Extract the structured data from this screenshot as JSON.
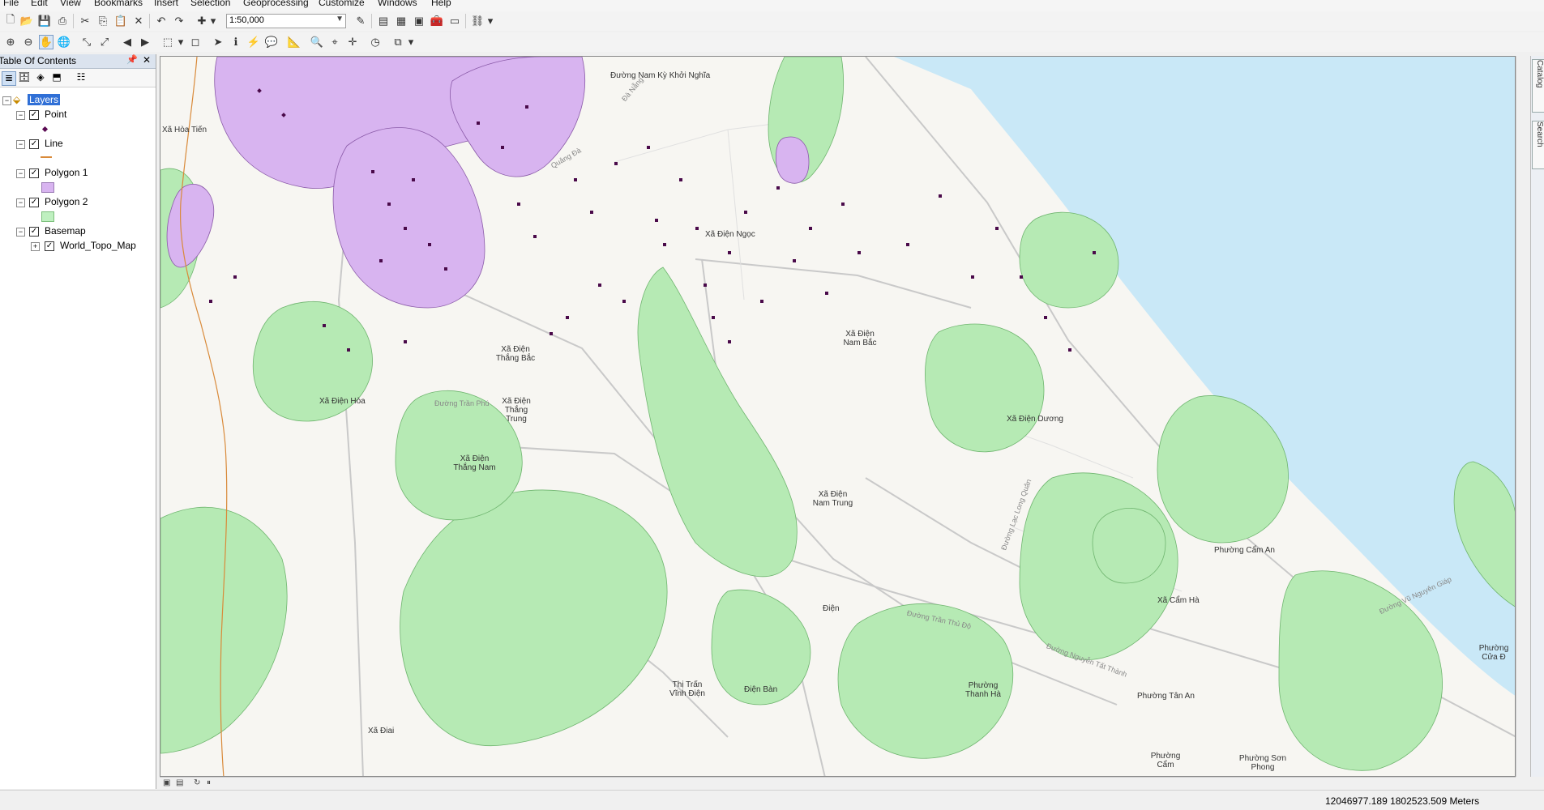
{
  "menu": [
    "File",
    "Edit",
    "View",
    "Bookmarks",
    "Insert",
    "Selection",
    "Geoprocessing",
    "Customize",
    "Windows",
    "Help"
  ],
  "toolbar": {
    "scale": "1:50,000"
  },
  "toc": {
    "title": "Table Of Contents",
    "layers_label": "Layers",
    "layers": [
      {
        "name": "Point",
        "symbol": "point",
        "color": "#5a0a52"
      },
      {
        "name": "Line",
        "symbol": "line",
        "color": "#d98a3a"
      },
      {
        "name": "Polygon 1",
        "symbol": "fill",
        "color": "#d8b4f0"
      },
      {
        "name": "Polygon 2",
        "symbol": "fill",
        "color": "#bff0c0"
      },
      {
        "name": "Basemap",
        "symbol": "group",
        "color": ""
      }
    ],
    "sublayer": "World_Topo_Map"
  },
  "map": {
    "labels": [
      "Xã Hòa Tiến",
      "Đường Nam Kỳ Khởi Nghĩa",
      "Xã Điện Ngọc",
      "Xã Điện Nam Bắc",
      "Xã Điện Hòa",
      "Xã Điện Thắng Bắc",
      "Xã Điện Thắng Trung",
      "Xã Điện Thắng Nam",
      "Xã Điện Dương",
      "Xã Điện Nam Trung",
      "Điện",
      "Thị Trấn Vĩnh Điện",
      "Điện Bàn",
      "Phường Thanh Hà",
      "Phường Cẩm An",
      "Xã Cẩm Hà",
      "Phường Tân An",
      "Phường Cẩm",
      "Phường Sơn Phong",
      "Xã Điai",
      "Phường Cửa Đ",
      "Đường Trần Phú",
      "Đường Trần Thủ Độ",
      "Đường Nguyễn Tất Thành",
      "Đường Lạc Long Quân",
      "Quảng Đà",
      "Đà Nẵng",
      "Đường Vũ Nguyên Giáp"
    ]
  },
  "status": {
    "coordinates": "12046977.189   1802523.509 Meters"
  },
  "right_dock": [
    "Catalog",
    "Search"
  ],
  "colors": {
    "water": "#c9e8f7",
    "forest": "#b6eab4",
    "purple": "#d8b4f0",
    "points": "#4a0a4a"
  }
}
